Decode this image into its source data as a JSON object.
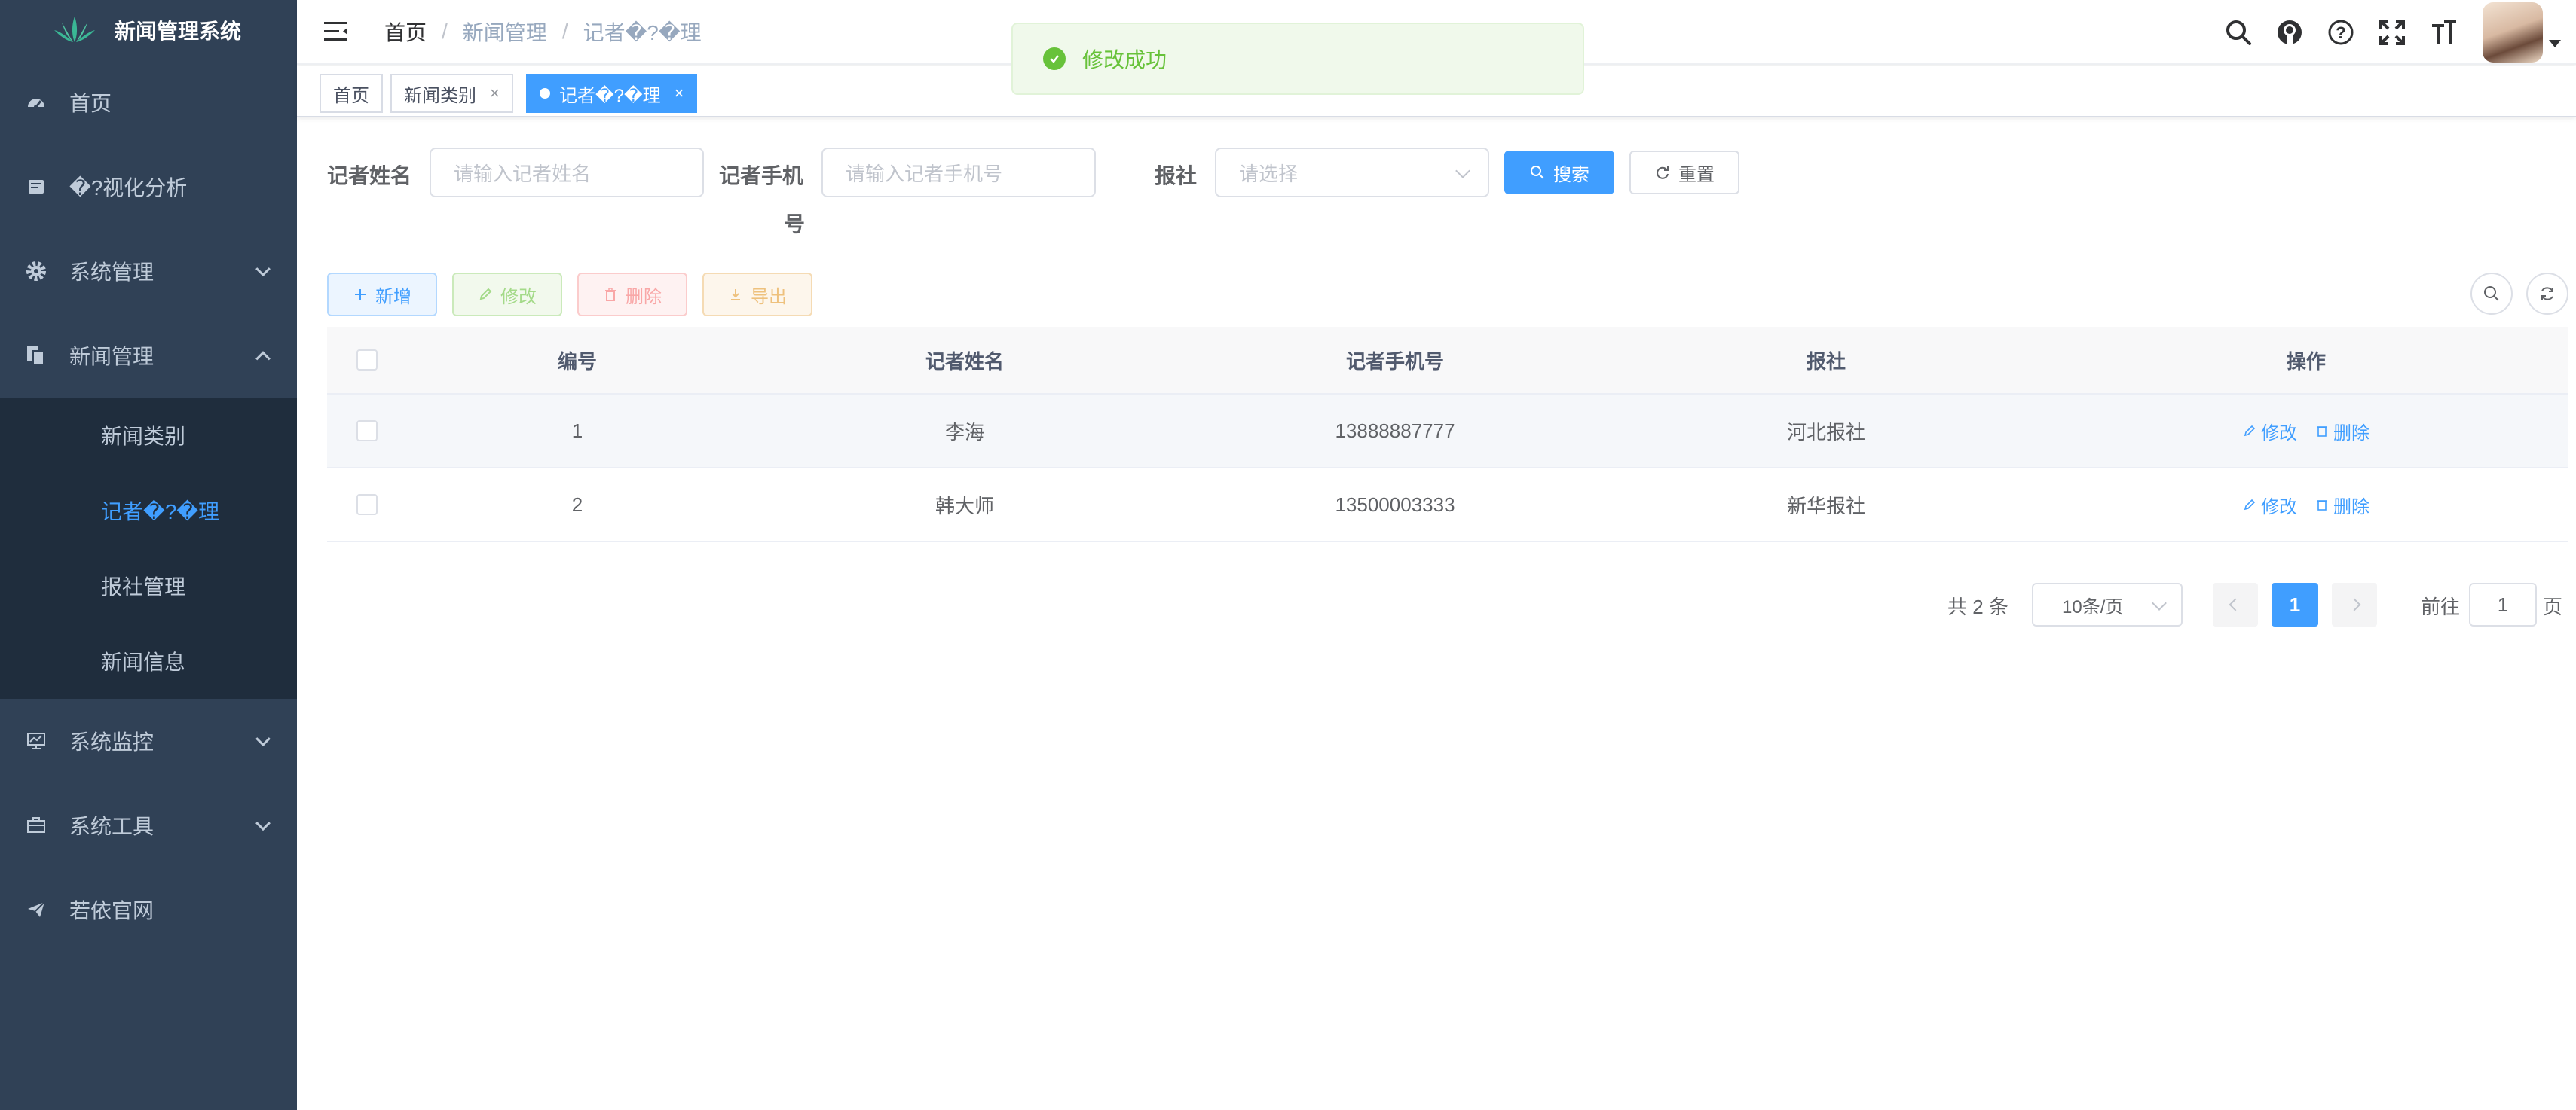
{
  "app": {
    "title": "新闻管理系统"
  },
  "sidebar": {
    "items": [
      {
        "label": "首页",
        "icon": "dashboard-icon"
      },
      {
        "label": "�?视化分析",
        "icon": "chart-icon"
      },
      {
        "label": "系统管理",
        "icon": "gear-icon",
        "expandable": true
      },
      {
        "label": "新闻管理",
        "icon": "documents-icon",
        "expanded": true
      },
      {
        "label": "系统监控",
        "icon": "monitor-icon",
        "expandable": true
      },
      {
        "label": "系统工具",
        "icon": "toolbox-icon",
        "expandable": true
      },
      {
        "label": "若依官网",
        "icon": "send-icon"
      }
    ],
    "submenu": [
      {
        "label": "新闻类别"
      },
      {
        "label": "记者�?�理",
        "active": true
      },
      {
        "label": "报社管理"
      },
      {
        "label": "新闻信息"
      }
    ]
  },
  "breadcrumb": [
    "首页",
    "新闻管理",
    "记者�?�理"
  ],
  "tags": [
    {
      "label": "首页"
    },
    {
      "label": "新闻类别",
      "closable": true
    },
    {
      "label": "记者�?�理",
      "active": true,
      "closable": true
    }
  ],
  "toast": {
    "message": "修改成功",
    "color": "#67c23a"
  },
  "search": {
    "name_label": "记者姓名",
    "name_placeholder": "请输入记者姓名",
    "phone_label_1": "记者手机",
    "phone_label_2": "号",
    "phone_placeholder": "请输入记者手机号",
    "paper_label": "报社",
    "paper_placeholder": "请选择",
    "search_button": "搜索",
    "reset_button": "重置"
  },
  "toolbar": {
    "add": "新增",
    "edit": "修改",
    "delete": "删除",
    "export": "导出"
  },
  "table": {
    "headers": [
      "编号",
      "记者姓名",
      "记者手机号",
      "报社",
      "操作"
    ],
    "rows": [
      {
        "id": "1",
        "name": "李海",
        "phone": "13888887777",
        "paper": "河北报社"
      },
      {
        "id": "2",
        "name": "韩大师",
        "phone": "13500003333",
        "paper": "新华报社"
      }
    ],
    "op_edit": "修改",
    "op_delete": "删除"
  },
  "pagination": {
    "total": "共 2 条",
    "page_size": "10条/页",
    "current_page": "1",
    "goto_label": "前往",
    "goto_value": "1",
    "page_suffix": "页"
  },
  "colors": {
    "primary": "#409eff",
    "sidebar_bg": "#304156",
    "submenu_bg": "#1f2d3d",
    "success": "#67c23a"
  }
}
